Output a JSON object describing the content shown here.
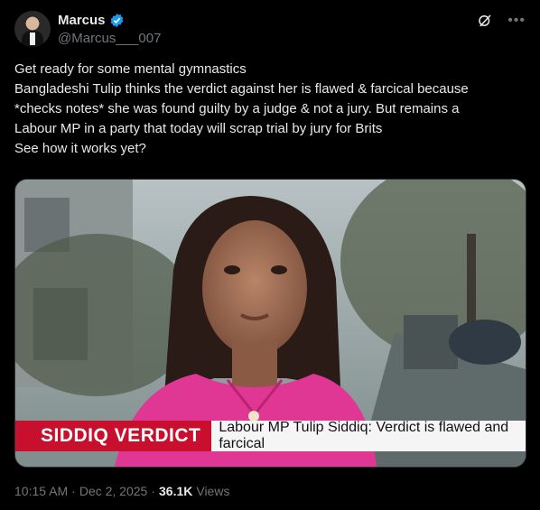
{
  "author": {
    "display_name": "Marcus",
    "handle": "@Marcus___007",
    "verified": true
  },
  "icons": {
    "verified": "verified-badge-icon",
    "grok": "grok-icon",
    "more": "more-icon"
  },
  "tweet": {
    "lines": [
      "Get ready for some mental gymnastics",
      "Bangladeshi Tulip thinks the verdict against her is flawed & farcical because",
      "*checks notes* she was found guilty by a judge & not a jury. But remains a",
      "Labour MP in a party that today will scrap trial by jury for Brits",
      "See how it works yet?"
    ]
  },
  "media": {
    "banner_label": "SIDDIQ VERDICT",
    "banner_text": "Labour MP Tulip Siddiq: Verdict is flawed and farcical"
  },
  "meta": {
    "time": "10:15 AM",
    "separator": "·",
    "date": "Dec 2, 2025",
    "separator2": "·",
    "views_count": "36.1K",
    "views_label": "Views"
  },
  "colors": {
    "background": "#000000",
    "text": "#e7e9ea",
    "muted": "#71767b",
    "verified": "#1d9bf0",
    "banner_red": "#c8102e"
  }
}
